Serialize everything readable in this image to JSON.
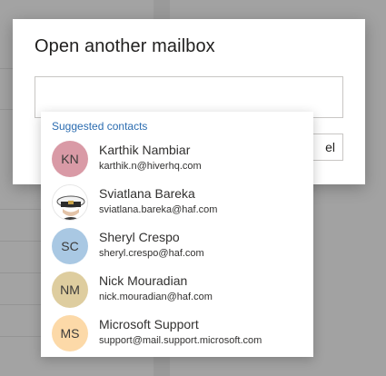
{
  "dialog": {
    "title": "Open another mailbox",
    "input_value": "",
    "cancel_label": "el"
  },
  "suggestions": {
    "header": "Suggested contacts",
    "contacts": [
      {
        "initials": "KN",
        "name": "Karthik Nambiar",
        "email": "karthik.n@hiverhq.com",
        "avatar_color": "#d99aa6",
        "photo": false
      },
      {
        "initials": "",
        "name": "Sviatlana Bareka",
        "email": "sviatlana.bareka@haf.com",
        "avatar_color": "#ffffff",
        "photo": true
      },
      {
        "initials": "SC",
        "name": "Sheryl Crespo",
        "email": "sheryl.crespo@haf.com",
        "avatar_color": "#a9c8e3",
        "photo": false
      },
      {
        "initials": "NM",
        "name": "Nick Mouradian",
        "email": "nick.mouradian@haf.com",
        "avatar_color": "#decd9f",
        "photo": false
      },
      {
        "initials": "MS",
        "name": "Microsoft Support",
        "email": "support@mail.support.microsoft.com",
        "avatar_color": "#fcd9a8",
        "photo": false
      }
    ]
  },
  "colors": {
    "accent_blue": "#2b6cb0",
    "overlay": "#8f8f8f"
  }
}
